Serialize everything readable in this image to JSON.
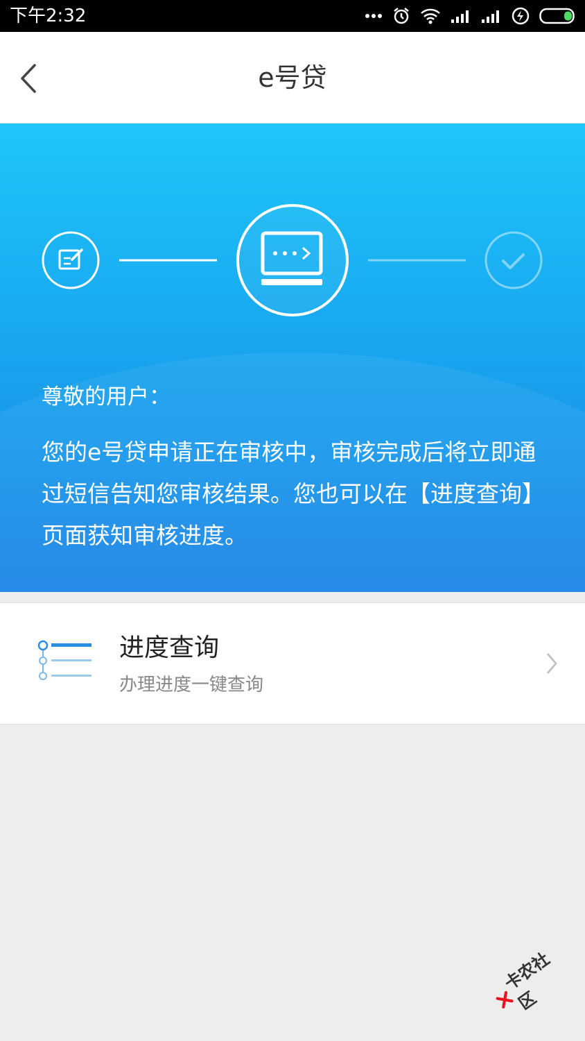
{
  "status_bar": {
    "time": "下午2:32",
    "icons": [
      "more-dots-icon",
      "alarm-icon",
      "wifi-icon",
      "signal-icon",
      "signal-icon",
      "charging-icon",
      "battery-icon"
    ]
  },
  "nav": {
    "title": "e号贷",
    "back_icon": "back-chevron-icon"
  },
  "progress": {
    "steps": [
      {
        "icon": "edit-form-icon",
        "state": "done"
      },
      {
        "icon": "computer-processing-icon",
        "state": "current"
      },
      {
        "icon": "check-icon",
        "state": "pending"
      }
    ]
  },
  "message": {
    "greeting": "尊敬的用户：",
    "body": "您的e号贷申请正在审核中，审核完成后将立即通过短信告知您审核结果。您也可以在【进度查询】页面获知审核进度。"
  },
  "progress_card": {
    "title": "进度查询",
    "subtitle": "办理进度一键查询",
    "icon": "progress-list-icon"
  },
  "watermark": {
    "text": "卡农社区"
  },
  "colors": {
    "hero_top": "#1ec6fb",
    "hero_bottom": "#1a84e6",
    "accent": "#2a8de6"
  }
}
